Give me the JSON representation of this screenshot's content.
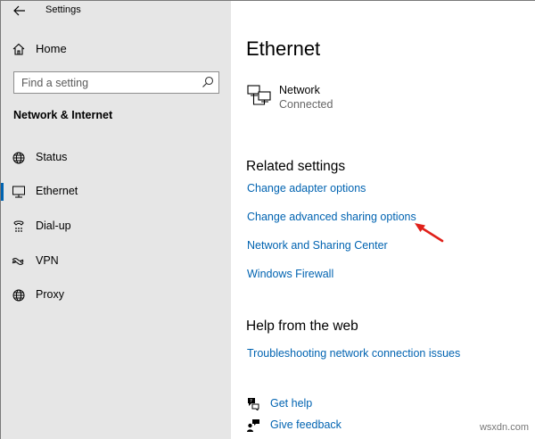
{
  "window": {
    "title": "Settings"
  },
  "sidebar": {
    "home_label": "Home",
    "search_placeholder": "Find a setting",
    "section_title": "Network & Internet",
    "items": [
      {
        "label": "Status",
        "icon": "globe-status-icon",
        "selected": false
      },
      {
        "label": "Ethernet",
        "icon": "ethernet-icon",
        "selected": true
      },
      {
        "label": "Dial-up",
        "icon": "dial-up-icon",
        "selected": false
      },
      {
        "label": "VPN",
        "icon": "vpn-icon",
        "selected": false
      },
      {
        "label": "Proxy",
        "icon": "globe-proxy-icon",
        "selected": false
      }
    ]
  },
  "main": {
    "title": "Ethernet",
    "network": {
      "name": "Network",
      "status": "Connected",
      "icon": "monitor-network-icon"
    },
    "related_heading": "Related settings",
    "related_links": [
      "Change adapter options",
      "Change advanced sharing options",
      "Network and Sharing Center",
      "Windows Firewall"
    ],
    "help_heading": "Help from the web",
    "help_links": [
      "Troubleshooting network connection issues"
    ],
    "footer_links": [
      {
        "label": "Get help",
        "icon": "get-help-icon"
      },
      {
        "label": "Give feedback",
        "icon": "feedback-icon"
      }
    ]
  },
  "annotation": {
    "color": "#e0201a",
    "icon": "red-arrow-icon"
  },
  "watermark": "wsxdn.com",
  "colors": {
    "accent": "#0063b1",
    "sidebar_bg": "#e6e6e6"
  }
}
